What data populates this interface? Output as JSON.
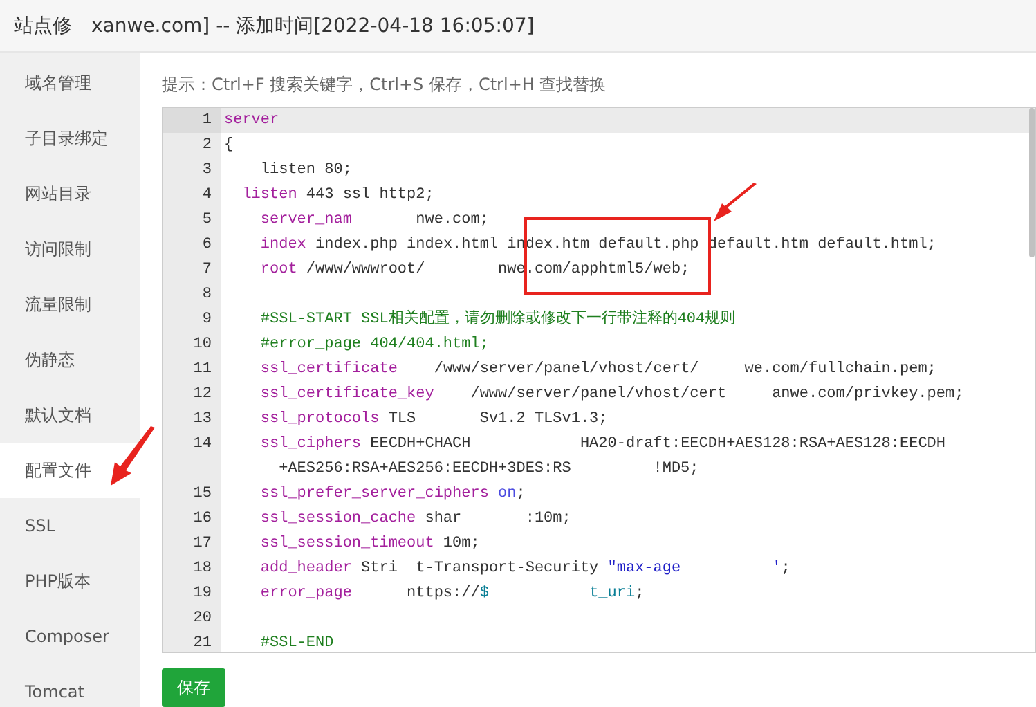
{
  "window": {
    "title_parts": [
      "站点修",
      "xanwe.com] -- 添加时间[2022-04-18 16:05:07]"
    ]
  },
  "sidebar": {
    "items": [
      {
        "label": "域名管理",
        "selected": false
      },
      {
        "label": "子目录绑定",
        "selected": false
      },
      {
        "label": "网站目录",
        "selected": false
      },
      {
        "label": "访问限制",
        "selected": false
      },
      {
        "label": "流量限制",
        "selected": false
      },
      {
        "label": "伪静态",
        "selected": false
      },
      {
        "label": "默认文档",
        "selected": false
      },
      {
        "label": "配置文件",
        "selected": true
      },
      {
        "label": "SSL",
        "selected": false
      },
      {
        "label": "PHP版本",
        "selected": false
      },
      {
        "label": "Composer",
        "selected": false
      },
      {
        "label": "Tomcat",
        "selected": false
      }
    ]
  },
  "hint": "提示：Ctrl+F 搜索关键字，Ctrl+S 保存，Ctrl+H 查找替换",
  "editor": {
    "lines": [
      {
        "number": "1",
        "active": true,
        "rows": [
          [
            {
              "kind": "keyword",
              "text": "server"
            }
          ]
        ]
      },
      {
        "number": "2",
        "active": false,
        "rows": [
          [
            {
              "kind": "plain",
              "text": "{"
            }
          ]
        ]
      },
      {
        "number": "3",
        "active": false,
        "rows": [
          [
            {
              "kind": "plain",
              "text": "    listen 80;"
            }
          ]
        ]
      },
      {
        "number": "4",
        "active": false,
        "rows": [
          [
            {
              "kind": "plain",
              "text": "  "
            },
            {
              "kind": "keyword",
              "text": "listen"
            },
            {
              "kind": "plain",
              "text": " 443 ssl http2;"
            }
          ]
        ]
      },
      {
        "number": "5",
        "active": false,
        "rows": [
          [
            {
              "kind": "plain",
              "text": "    "
            },
            {
              "kind": "keyword",
              "text": "server_nam"
            },
            {
              "kind": "plain",
              "text": "       nwe.com;"
            }
          ]
        ]
      },
      {
        "number": "6",
        "active": false,
        "rows": [
          [
            {
              "kind": "plain",
              "text": "    "
            },
            {
              "kind": "keyword",
              "text": "index"
            },
            {
              "kind": "plain",
              "text": " index.php index.html index.htm default.php default.htm default.html;"
            }
          ]
        ]
      },
      {
        "number": "7",
        "active": false,
        "rows": [
          [
            {
              "kind": "plain",
              "text": "    "
            },
            {
              "kind": "keyword",
              "text": "root"
            },
            {
              "kind": "plain",
              "text": " /www/wwwroot/        nwe.com/apphtml5/web;"
            }
          ]
        ]
      },
      {
        "number": "8",
        "active": false,
        "rows": [
          []
        ]
      },
      {
        "number": "9",
        "active": false,
        "rows": [
          [
            {
              "kind": "plain",
              "text": "    "
            },
            {
              "kind": "comment",
              "text": "#SSL-START SSL相关配置，请勿删除或修改下一行带注释的404规则"
            }
          ]
        ]
      },
      {
        "number": "10",
        "active": false,
        "rows": [
          [
            {
              "kind": "plain",
              "text": "    "
            },
            {
              "kind": "comment",
              "text": "#error_page 404/404.html;"
            }
          ]
        ]
      },
      {
        "number": "11",
        "active": false,
        "rows": [
          [
            {
              "kind": "plain",
              "text": "    "
            },
            {
              "kind": "keyword",
              "text": "ssl_certificate"
            },
            {
              "kind": "plain",
              "text": "    /www/server/panel/vhost/cert/     we.com/fullchain.pem;"
            }
          ]
        ]
      },
      {
        "number": "12",
        "active": false,
        "rows": [
          [
            {
              "kind": "plain",
              "text": "    "
            },
            {
              "kind": "keyword",
              "text": "ssl_certificate_key"
            },
            {
              "kind": "plain",
              "text": "    /www/server/panel/vhost/cert     anwe.com/privkey.pem;"
            }
          ]
        ]
      },
      {
        "number": "13",
        "active": false,
        "rows": [
          [
            {
              "kind": "plain",
              "text": "    "
            },
            {
              "kind": "keyword",
              "text": "ssl_protocols"
            },
            {
              "kind": "plain",
              "text": " TLS       Sv1.2 TLSv1.3;"
            }
          ]
        ]
      },
      {
        "number": "14",
        "active": false,
        "rows": [
          [
            {
              "kind": "plain",
              "text": "    "
            },
            {
              "kind": "keyword",
              "text": "ssl_ciphers"
            },
            {
              "kind": "plain",
              "text": " EECDH+CHACH            HA20-draft:EECDH+AES128:RSA+AES128:EECDH"
            }
          ],
          [
            {
              "kind": "plain",
              "text": "      +AES256:RSA+AES256:EECDH+3DES:RS         !MD5;"
            }
          ]
        ]
      },
      {
        "number": "15",
        "active": false,
        "rows": [
          [
            {
              "kind": "plain",
              "text": "    "
            },
            {
              "kind": "keyword",
              "text": "ssl_prefer_server_ciphers"
            },
            {
              "kind": "plain",
              "text": " "
            },
            {
              "kind": "atom",
              "text": "on"
            },
            {
              "kind": "plain",
              "text": ";"
            }
          ]
        ]
      },
      {
        "number": "16",
        "active": false,
        "rows": [
          [
            {
              "kind": "plain",
              "text": "    "
            },
            {
              "kind": "keyword",
              "text": "ssl_session_cache"
            },
            {
              "kind": "plain",
              "text": " shar       :10m;"
            }
          ]
        ]
      },
      {
        "number": "17",
        "active": false,
        "rows": [
          [
            {
              "kind": "plain",
              "text": "    "
            },
            {
              "kind": "keyword",
              "text": "ssl_session_timeout"
            },
            {
              "kind": "plain",
              "text": " 10m;"
            }
          ]
        ]
      },
      {
        "number": "18",
        "active": false,
        "rows": [
          [
            {
              "kind": "plain",
              "text": "    "
            },
            {
              "kind": "keyword",
              "text": "add_header"
            },
            {
              "kind": "plain",
              "text": " Stri  t-Transport-Security "
            },
            {
              "kind": "string",
              "text": "\"max-age"
            },
            {
              "kind": "plain",
              "text": "          "
            },
            {
              "kind": "string",
              "text": "'"
            },
            {
              "kind": "plain",
              "text": ";"
            }
          ]
        ]
      },
      {
        "number": "19",
        "active": false,
        "rows": [
          [
            {
              "kind": "plain",
              "text": "    "
            },
            {
              "kind": "keyword",
              "text": "error_page"
            },
            {
              "kind": "plain",
              "text": "      nttps://"
            },
            {
              "kind": "variable",
              "text": "$"
            },
            {
              "kind": "plain",
              "text": "           "
            },
            {
              "kind": "variable",
              "text": "t_uri"
            },
            {
              "kind": "plain",
              "text": ";"
            }
          ]
        ]
      },
      {
        "number": "20",
        "active": false,
        "rows": [
          []
        ]
      },
      {
        "number": "21",
        "active": false,
        "rows": [
          [
            {
              "kind": "plain",
              "text": "    "
            },
            {
              "kind": "comment",
              "text": "#SSL-END"
            }
          ]
        ]
      }
    ]
  },
  "save_button": "保存"
}
